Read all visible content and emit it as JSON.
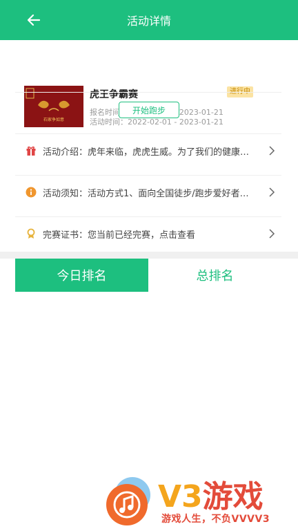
{
  "header": {
    "title": "活动详情",
    "back_icon": "arrow-left-icon"
  },
  "activity": {
    "title": "虎王争霸赛",
    "status": "进行中",
    "signup_time": "报名时间：2022-01-27 - 2023-01-21",
    "activity_time": "活动时间：2022-02-01 - 2023-01-21",
    "thumbnail_caption": "石家争如意",
    "start_button": "开始跑步"
  },
  "info_rows": [
    {
      "icon": "gift-icon",
      "label": "活动介绍：",
      "text": "虎年来临，虎虎生威。为了我们的健康…"
    },
    {
      "icon": "info-icon",
      "label": "活动须知：",
      "text": "活动方式1、面向全国徒步/跑步爱好者…"
    },
    {
      "icon": "medal-icon",
      "label": "完赛证书：",
      "text": "您当前已经完赛，点击查看"
    }
  ],
  "tabs": [
    {
      "label": "今日排名",
      "active": true
    },
    {
      "label": "总排名",
      "active": false
    }
  ],
  "watermark": {
    "brand": "V3游戏",
    "slogan": "游戏人生，不负VVVV3"
  },
  "colors": {
    "primary": "#1dbf7f",
    "status_bg": "#fbe3a3",
    "status_text": "#c78a00"
  }
}
